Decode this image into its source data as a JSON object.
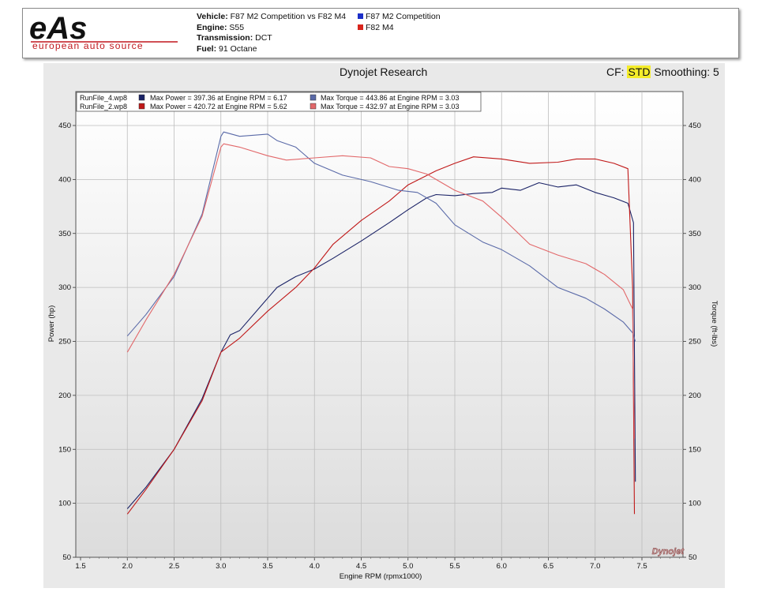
{
  "header": {
    "logo_text": "eAs",
    "logo_tagline": "european auto source",
    "vehicle_label": "Vehicle:",
    "vehicle_value": "F87 M2 Competition vs F82 M4",
    "engine_label": "Engine:",
    "engine_value": "S55",
    "transmission_label": "Transmission:",
    "transmission_value": "DCT",
    "fuel_label": "Fuel:",
    "fuel_value": "91 Octane",
    "legend": [
      {
        "name": "F87 M2 Competition",
        "color": "#1c2fc8"
      },
      {
        "name": "F82 M4",
        "color": "#d8241c"
      }
    ]
  },
  "chart_title": "Dynojet Research",
  "cf": {
    "prefix": "CF:",
    "value": "STD",
    "smoothing": "Smoothing: 5"
  },
  "watermark": "Dynojet",
  "chart_legend": [
    {
      "file": "RunFile_4.wp8",
      "max_power": "Max Power = 397.36 at Engine RPM = 6.17",
      "max_torque": "Max Torque = 443.86 at Engine RPM = 3.03",
      "color": "#1a2266"
    },
    {
      "file": "RunFile_2.wp8",
      "max_power": "Max Power = 420.72 at Engine RPM = 5.62",
      "max_torque": "Max Torque = 432.97 at Engine RPM = 3.03",
      "color": "#c01818"
    }
  ],
  "chart_data": {
    "type": "line",
    "xlabel": "Engine RPM (rpmx1000)",
    "ylabel": "Power (hp)",
    "y2label": "Torque (ft-lbs)",
    "xlim": [
      1.5,
      8.0
    ],
    "ylim": [
      50,
      460
    ],
    "x_ticks": [
      "1.5",
      "2.0",
      "2.5",
      "3.0",
      "3.5",
      "4.0",
      "4.5",
      "5.0",
      "5.5",
      "6.0",
      "6.5",
      "7.0",
      "7.5"
    ],
    "y_ticks": [
      "50",
      "100",
      "150",
      "200",
      "250",
      "300",
      "350",
      "400",
      "450"
    ],
    "y2_ticks": [
      "50",
      "100",
      "150",
      "200",
      "250",
      "300",
      "350",
      "400",
      "450"
    ],
    "grid": true,
    "series": [
      {
        "name": "RunFile_4.wp8",
        "measure": "power",
        "color": "#1a2266",
        "x": [
          2.0,
          2.2,
          2.5,
          2.8,
          3.0,
          3.1,
          3.2,
          3.5,
          3.6,
          3.8,
          4.0,
          4.2,
          4.5,
          4.8,
          5.0,
          5.2,
          5.3,
          5.5,
          5.7,
          5.9,
          6.0,
          6.2,
          6.4,
          6.6,
          6.8,
          7.0,
          7.2,
          7.35,
          7.41,
          7.43
        ],
        "y": [
          95,
          115,
          150,
          197,
          240,
          256,
          260,
          290,
          300,
          310,
          317,
          327,
          343,
          360,
          372,
          383,
          386,
          385,
          387,
          388,
          392,
          390,
          397,
          393,
          395,
          388,
          383,
          378,
          360,
          120
        ]
      },
      {
        "name": "RunFile_2.wp8",
        "measure": "power",
        "color": "#c01818",
        "x": [
          2.0,
          2.2,
          2.5,
          2.8,
          3.0,
          3.2,
          3.5,
          3.8,
          4.0,
          4.2,
          4.5,
          4.8,
          5.0,
          5.3,
          5.5,
          5.7,
          6.0,
          6.3,
          6.6,
          6.8,
          7.0,
          7.2,
          7.35,
          7.4,
          7.42
        ],
        "y": [
          90,
          113,
          150,
          195,
          240,
          253,
          278,
          300,
          318,
          340,
          362,
          380,
          395,
          408,
          415,
          421,
          419,
          415,
          416,
          419,
          419,
          415,
          410,
          300,
          90
        ]
      },
      {
        "name": "RunFile_4.wp8",
        "measure": "torque",
        "color": "#5a6aa8",
        "x": [
          2.0,
          2.2,
          2.5,
          2.8,
          3.0,
          3.03,
          3.2,
          3.5,
          3.6,
          3.8,
          4.0,
          4.3,
          4.6,
          4.9,
          5.1,
          5.3,
          5.5,
          5.8,
          6.0,
          6.3,
          6.6,
          6.9,
          7.1,
          7.3,
          7.4,
          7.43
        ],
        "y": [
          255,
          275,
          310,
          368,
          440,
          444,
          440,
          442,
          436,
          430,
          415,
          404,
          398,
          390,
          388,
          378,
          358,
          342,
          335,
          320,
          300,
          290,
          280,
          268,
          258,
          250
        ]
      },
      {
        "name": "RunFile_2.wp8",
        "measure": "torque",
        "color": "#e2686a",
        "x": [
          2.0,
          2.2,
          2.5,
          2.8,
          3.0,
          3.03,
          3.2,
          3.5,
          3.7,
          4.0,
          4.3,
          4.6,
          4.8,
          5.0,
          5.2,
          5.5,
          5.8,
          6.0,
          6.3,
          6.6,
          6.9,
          7.1,
          7.3,
          7.4,
          7.42
        ],
        "y": [
          240,
          270,
          312,
          366,
          430,
          433,
          430,
          422,
          418,
          420,
          422,
          420,
          412,
          410,
          405,
          390,
          380,
          365,
          340,
          330,
          322,
          312,
          298,
          280,
          160
        ]
      }
    ]
  }
}
